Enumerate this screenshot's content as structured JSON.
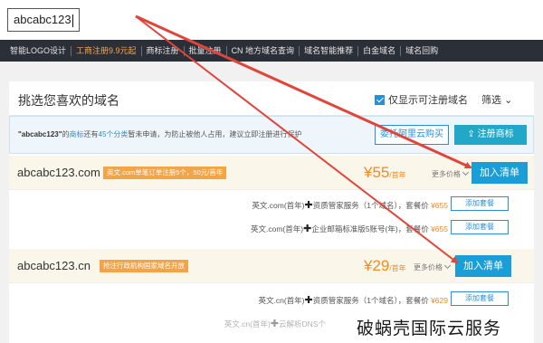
{
  "search": {
    "value": "abcabc123"
  },
  "nav": {
    "items": [
      {
        "label": "智能LOGO设计",
        "hot": false
      },
      {
        "label": "工商注册9.9元起",
        "hot": true
      },
      {
        "label": "商标注册",
        "hot": false
      },
      {
        "label": "批量注册",
        "hot": false
      },
      {
        "label": "CN 地方域名查询",
        "hot": false
      },
      {
        "label": "域名智能推荐",
        "hot": false
      },
      {
        "label": "白金域名",
        "hot": false
      },
      {
        "label": "域名回购",
        "hot": false
      }
    ]
  },
  "panel": {
    "title": "挑选您喜欢的域名",
    "only_available_label": "仅显示可注册域名",
    "filter_label": "筛选"
  },
  "notice": {
    "quoted_name": "\"abcabc123\"",
    "part1": "的",
    "trademark_word": "商标",
    "part2": "还有",
    "classes": "45个分类",
    "part3": "暂未申请，为防止被他人占用，建议立即注册进行保护",
    "hosting_button": "委托阿里云购买",
    "trademark_button": "注册商标"
  },
  "rows": [
    {
      "domain": "abcabc123.com",
      "promo": "英文.com单笔订单注册5个，50元/首年",
      "price": "¥55",
      "unit": "/首年",
      "more": "更多价格",
      "add": "加入清单",
      "bundles": [
        {
          "text": "英文.com(首年)",
          "service": "资质管家服务（1个域名），套餐价",
          "price": "¥655",
          "button": "添加套餐"
        },
        {
          "text": "英文.com(首年)",
          "service": "企业邮箱标准版5账号(年)，套餐价",
          "price": "¥655",
          "button": "添加套餐"
        }
      ]
    },
    {
      "domain": "abcabc123.cn",
      "promo": "抢注行政机构国家域名开放",
      "price": "¥29",
      "unit": "/首年",
      "more": "更多价格",
      "add": "加入清单",
      "bundles": [
        {
          "text": "英文.cn(首年)",
          "service": "资质管家服务（1个域名），套餐价",
          "price": "¥629",
          "button": "添加套餐"
        },
        {
          "text": "英文.cn(首年)",
          "service": "云解析DNS个",
          "price": "",
          "button": ""
        }
      ]
    }
  ],
  "watermark": "破蜗壳国际云服务",
  "colors": {
    "arrow": "#e0443a",
    "accent": "#1b9ed7",
    "price": "#f08a24"
  }
}
